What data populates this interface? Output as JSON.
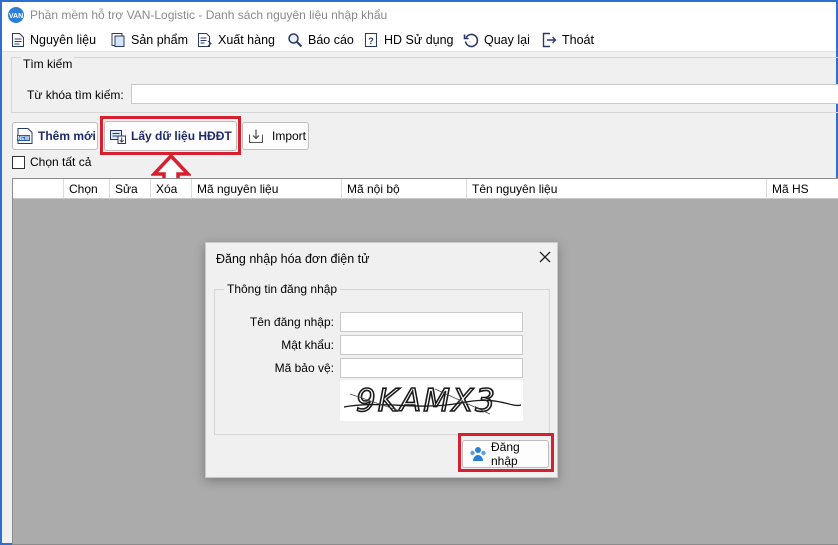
{
  "window": {
    "title": "Phần mềm hỗ trợ VAN-Logistic - Danh sách nguyên liệu nhập khẩu"
  },
  "menu": [
    {
      "label": "Nguyên liệu",
      "icon": "document-icon"
    },
    {
      "label": "Sản phẩm",
      "icon": "product-icon"
    },
    {
      "label": "Xuất hàng",
      "icon": "export-list-icon"
    },
    {
      "label": "Báo cáo",
      "icon": "search-report-icon"
    },
    {
      "label": "HD Sử dụng",
      "icon": "help-document-icon"
    },
    {
      "label": "Quay lại",
      "icon": "refresh-back-icon"
    },
    {
      "label": "Thoát",
      "icon": "exit-door-icon"
    }
  ],
  "search": {
    "group_title": "Tìm kiếm",
    "keyword_label": "Từ khóa tìm kiếm:",
    "keyword_value": ""
  },
  "toolbar": {
    "add_label": "Thêm mới",
    "get_invoice_label": "Lấy dữ liệu HĐĐT",
    "import_label": "Import"
  },
  "select_all": {
    "label": "Chọn tất cả",
    "checked": false
  },
  "grid": {
    "columns": [
      "Chọn",
      "Sửa",
      "Xóa",
      "Mã nguyên liệu",
      "Mã nội bộ",
      "Tên nguyên liệu",
      "Mã HS"
    ],
    "rows": []
  },
  "login_dialog": {
    "title": "Đăng nhập hóa đơn điện tử",
    "group_title": "Thông tin đăng nhập",
    "username_label": "Tên đăng nhập:",
    "password_label": "Mật khẩu:",
    "captcha_label": "Mã bảo vệ:",
    "username_value": "",
    "password_value": "",
    "captcha_value": "",
    "captcha_text": "9KAMX3",
    "login_label": "Đăng nhập"
  },
  "colors": {
    "highlight": "#d62030",
    "window_border": "#2f6fd1",
    "grid_background": "#ababab",
    "button_text": "#1f2a6b"
  }
}
